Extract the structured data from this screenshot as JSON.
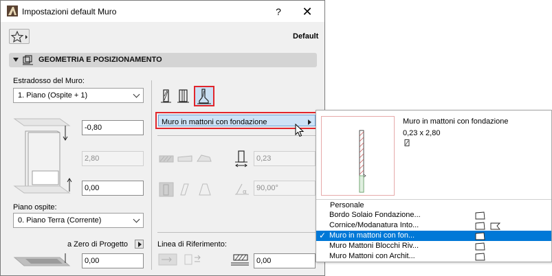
{
  "window": {
    "title": "Impostazioni default Muro",
    "help_label": "?",
    "close_label": "✕"
  },
  "toolbar": {
    "default_label": "Default"
  },
  "section": {
    "title": "GEOMETRIA E POSIZIONAMENTO"
  },
  "top_linked": {
    "label": "Estradosso del Muro:",
    "value": "1. Piano (Ospite + 1)"
  },
  "offsets": {
    "top_offset": "-0,80",
    "height": "2,80",
    "base_offset": "0,00"
  },
  "home_story": {
    "label": "Piano ospite:",
    "value": "0. Piano Terra (Corrente)"
  },
  "to_project_zero": {
    "label": "a Zero di Progetto",
    "value": "0,00"
  },
  "profile": {
    "selected_label": "Muro in mattoni con fondazione"
  },
  "thickness": {
    "value": "0,23"
  },
  "angle": {
    "value": "90,00°"
  },
  "reference_line": {
    "label": "Linea di Riferimento:",
    "offset": "0,00"
  },
  "popup": {
    "preview_name": "Muro in mattoni con fondazione",
    "preview_size": "0,23 x 2,80",
    "items": [
      {
        "label": "Personale",
        "selected": false
      },
      {
        "label": "Bordo Solaio Fondazione...",
        "selected": false
      },
      {
        "label": "Cornice/Modanatura Into...",
        "selected": false
      },
      {
        "label": "Muro in mattoni con fon...",
        "selected": true
      },
      {
        "label": "Muro Mattoni Blocchi Riv...",
        "selected": false
      },
      {
        "label": "Muro Mattoni con Archit...",
        "selected": false
      }
    ],
    "check_glyph": "✓"
  },
  "colors": {
    "highlight_red": "#e1252b",
    "selection_blue": "#0078d7",
    "button_blue": "#cde3f7"
  }
}
